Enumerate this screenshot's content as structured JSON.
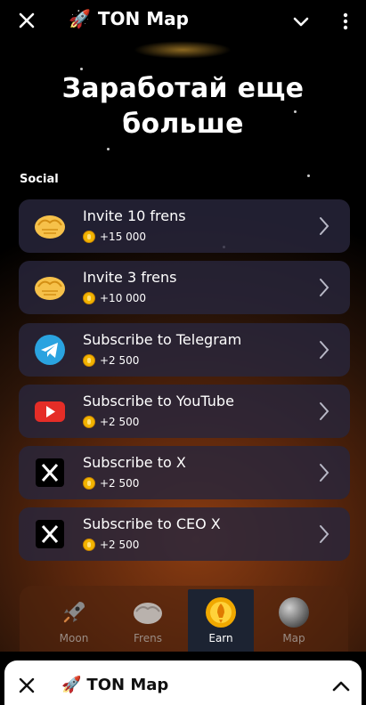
{
  "topbar": {
    "title": "TON Map",
    "title_icon": "rocket-emoji"
  },
  "main": {
    "heading_line1": "Заработай еще",
    "heading_line2": "больше",
    "section_label": "Social"
  },
  "tasks": [
    {
      "label": "Invite 10 frens",
      "reward": "+15 000",
      "icon": "handshake-icon"
    },
    {
      "label": "Invite 3 frens",
      "reward": "+10 000",
      "icon": "handshake-icon"
    },
    {
      "label": "Subscribe to Telegram",
      "reward": "+2 500",
      "icon": "telegram-icon"
    },
    {
      "label": "Subscribe to YouTube",
      "reward": "+2 500",
      "icon": "youtube-icon"
    },
    {
      "label": "Subscribe to X",
      "reward": "+2 500",
      "icon": "x-logo-icon"
    },
    {
      "label": "Subscribe to CEO X",
      "reward": "+2 500",
      "icon": "x-logo-icon"
    }
  ],
  "nav": {
    "tabs": [
      {
        "label": "Moon",
        "icon": "rocket-icon"
      },
      {
        "label": "Frens",
        "icon": "handshake-icon"
      },
      {
        "label": "Earn",
        "icon": "coin-icon"
      },
      {
        "label": "Map",
        "icon": "planet-icon"
      }
    ],
    "active": "Earn"
  },
  "bottom": {
    "title": "TON Map"
  },
  "colors": {
    "accent": "#f2b400",
    "card_bg": "#28263c",
    "active_tab_bg": "#1c2332"
  }
}
